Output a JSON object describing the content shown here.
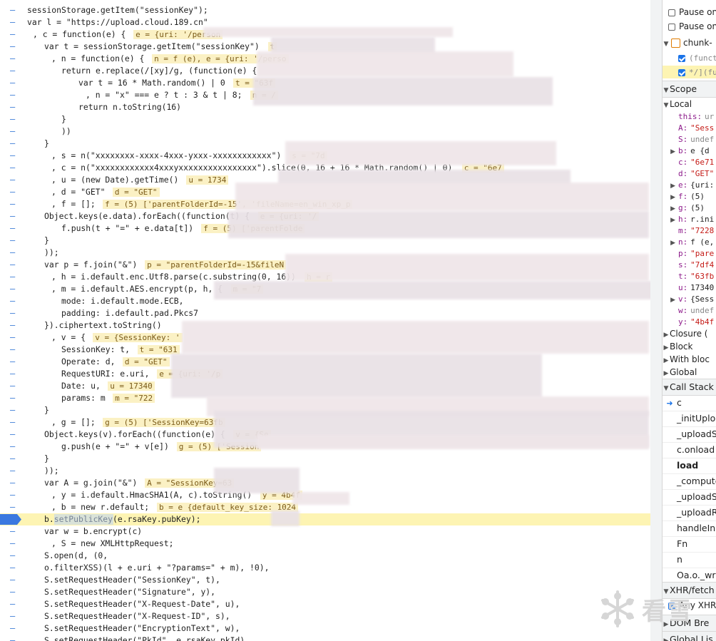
{
  "code": {
    "lines": [
      {
        "text": "sessionStorage.getItem(\"sessionKey\");",
        "indent": 38
      },
      {
        "text": "var l = \"https://upload.cloud.189.cn\"",
        "indent": 38
      },
      {
        "text": ", c = function(e) {",
        "indent": 46,
        "inline": "e = {uri: '/person"
      },
      {
        "text": "var t = sessionStorage.getItem(\"sessionKey\")",
        "indent": 62,
        "inline": "t"
      },
      {
        "text": ", n = function(e) {",
        "indent": 72,
        "inline": "n = f (e), e = {uri: '/perso"
      },
      {
        "text": "return e.replace(/[xy]/g, (function(e) {",
        "indent": 86
      },
      {
        "text": "var t = 16 * Math.random() | 0",
        "indent": 110,
        "inline": "t = \"63f"
      },
      {
        "text": ", n = \"x\" === e ? t : 3 & t | 8;",
        "indent": 120,
        "inline": "n = /"
      },
      {
        "text": "return n.toString(16)",
        "indent": 110
      },
      {
        "text": "}",
        "indent": 86
      },
      {
        "text": "))",
        "indent": 86
      },
      {
        "text": "}",
        "indent": 62
      },
      {
        "text": ", s = n(\"xxxxxxxx-xxxx-4xxx-yxxx-xxxxxxxxxxxx\")",
        "indent": 72,
        "inline": "s = \"7d"
      },
      {
        "text": ", c = n(\"xxxxxxxxxxxx4xxxyxxxxxxxxxxxxxxxx\").slice(0, 16 + 16 * Math.random() | 0)",
        "indent": 72,
        "inline": "c = \"6e7"
      },
      {
        "text": ", u = (new Date).getTime()",
        "indent": 72,
        "inline": "u = 1734"
      },
      {
        "text": ", d = \"GET\"",
        "indent": 72,
        "inline": "d = \"GET\""
      },
      {
        "text": ", f = [];",
        "indent": 72,
        "inline": "f = (5) ['parentFolderId=-15', 'fileName=en_win_xp_p"
      },
      {
        "text": "Object.keys(e.data).forEach((function(t) {",
        "indent": 62,
        "inline": "e = {uri: '/"
      },
      {
        "text": "f.push(t + \"=\" + e.data[t])",
        "indent": 86,
        "inline": "f = (5) ['parentFolde"
      },
      {
        "text": "}",
        "indent": 62
      },
      {
        "text": "));",
        "indent": 62
      },
      {
        "text": "var p = f.join(\"&\")",
        "indent": 62,
        "inline": "p = \"parentFolderId=-15&fileN"
      },
      {
        "text": ", h = i.default.enc.Utf8.parse(c.substring(0, 16))",
        "indent": 72,
        "inline": "h = r"
      },
      {
        "text": ", m = i.default.AES.encrypt(p, h, {",
        "indent": 72,
        "inline": "m = \"7"
      },
      {
        "text": "mode: i.default.mode.ECB,",
        "indent": 86
      },
      {
        "text": "padding: i.default.pad.Pkcs7",
        "indent": 86
      },
      {
        "text": "}).ciphertext.toString()",
        "indent": 62
      },
      {
        "text": ", v = {",
        "indent": 72,
        "inline": "v = {SessionKey: '"
      },
      {
        "text": "SessionKey: t,",
        "indent": 86,
        "inline": "t = \"631"
      },
      {
        "text": "Operate: d,",
        "indent": 86,
        "inline": "d = \"GET\""
      },
      {
        "text": "RequestURI: e.uri,",
        "indent": 86,
        "inline": "e = {uri: '/p"
      },
      {
        "text": "Date: u,",
        "indent": 86,
        "inline": "u = 17340"
      },
      {
        "text": "params: m",
        "indent": 86,
        "inline": "m = \"722"
      },
      {
        "text": "}",
        "indent": 62
      },
      {
        "text": ", g = [];",
        "indent": 72,
        "inline": "g = (5) ['SessionKey=63fb"
      },
      {
        "text": "Object.keys(v).forEach((function(e) {",
        "indent": 62,
        "inline": "v = {Se"
      },
      {
        "text": "g.push(e + \"=\" + v[e])",
        "indent": 86,
        "inline": "g = (5) ['Session"
      },
      {
        "text": "}",
        "indent": 62
      },
      {
        "text": "));",
        "indent": 62
      },
      {
        "text": "var A = g.join(\"&\")",
        "indent": 62,
        "inline": "A = \"SessionKey=63"
      },
      {
        "text": ", y = i.default.HmacSHA1(A, c).toString()",
        "indent": 72,
        "inline": "y = 4b4f"
      },
      {
        "text": ", b = new r.default;",
        "indent": 72,
        "inline": "b = e {default_key_size: 1024"
      },
      {
        "text": "b.setPublicKey(e.rsaKey.pubKey);",
        "indent": 62,
        "current": true
      },
      {
        "text": "var w = b.encrypt(c)",
        "indent": 62
      },
      {
        "text": ", S = new XMLHttpRequest;",
        "indent": 72
      },
      {
        "text": "S.open(d, (0,",
        "indent": 62
      },
      {
        "text": "o.filterXSS)(l + e.uri + \"?params=\" + m), !0),",
        "indent": 62
      },
      {
        "text": "S.setRequestHeader(\"SessionKey\", t),",
        "indent": 62
      },
      {
        "text": "S.setRequestHeader(\"Signature\", y),",
        "indent": 62
      },
      {
        "text": "S.setRequestHeader(\"X-Request-Date\", u),",
        "indent": 62
      },
      {
        "text": "S.setRequestHeader(\"X-Request-ID\", s),",
        "indent": 62
      },
      {
        "text": "S.setRequestHeader(\"EncryptionText\", w),",
        "indent": 62
      },
      {
        "text": "S.setRequestHeader(\"PkId\", e.rsaKey.pkId),",
        "indent": 62
      }
    ],
    "gutter_mark": "–"
  },
  "sidebar": {
    "pause_options": [
      "Pause on",
      "Pause on"
    ],
    "breakpoints_file": "chunk-",
    "breakpoint_items": [
      "(funct",
      "*/](fu"
    ],
    "scope_title": "Scope",
    "local_title": "Local",
    "local_vars": [
      {
        "name": "this:",
        "value": "ur",
        "kind": "gray"
      },
      {
        "name": "A:",
        "value": "\"Sess",
        "kind": "str"
      },
      {
        "name": "S:",
        "value": "undef",
        "kind": "gray"
      },
      {
        "name": "b:",
        "value": "e {d",
        "kind": "obj",
        "expand": true
      },
      {
        "name": "c:",
        "value": "\"6e71",
        "kind": "str"
      },
      {
        "name": "d:",
        "value": "\"GET\"",
        "kind": "str"
      },
      {
        "name": "e:",
        "value": "{uri:",
        "kind": "obj",
        "expand": true
      },
      {
        "name": "f:",
        "value": "(5)",
        "kind": "obj",
        "expand": true
      },
      {
        "name": "g:",
        "value": "(5)",
        "kind": "obj",
        "expand": true
      },
      {
        "name": "h:",
        "value": "r.ini",
        "kind": "obj",
        "expand": true
      },
      {
        "name": "m:",
        "value": "\"7228",
        "kind": "str"
      },
      {
        "name": "n:",
        "value": "f (e,",
        "kind": "obj",
        "expand": true
      },
      {
        "name": "p:",
        "value": "\"pare",
        "kind": "str"
      },
      {
        "name": "s:",
        "value": "\"7df4",
        "kind": "str"
      },
      {
        "name": "t:",
        "value": "\"63fb",
        "kind": "str"
      },
      {
        "name": "u:",
        "value": "17340",
        "kind": "num"
      },
      {
        "name": "v:",
        "value": "{Sess",
        "kind": "obj",
        "expand": true
      },
      {
        "name": "w:",
        "value": "undef",
        "kind": "gray"
      },
      {
        "name": "y:",
        "value": "\"4b4f",
        "kind": "str"
      }
    ],
    "scope_groups": [
      "Closure (",
      "Block",
      "With bloc",
      "Global"
    ],
    "call_stack_title": "Call Stack",
    "call_stack": [
      {
        "label": "c",
        "active": true
      },
      {
        "label": "_initUplo"
      },
      {
        "label": "_uploadSt"
      },
      {
        "label": "c.onload"
      },
      {
        "label": "load",
        "bold": true
      },
      {
        "label": "_compute"
      },
      {
        "label": "_uploadSt"
      },
      {
        "label": "_uploadRe"
      },
      {
        "label": "handleInp"
      },
      {
        "label": "Fn"
      },
      {
        "label": "n"
      },
      {
        "label": "Oa.o._wra"
      }
    ],
    "xhr_title": "XHR/fetch",
    "any_xhr": "Any XHR",
    "dom_breakpoints": "DOM Bre",
    "global_listeners": "Global Lis"
  },
  "watermark": {
    "text": "看雪"
  },
  "colors": {
    "accent": "#1a73e8",
    "current_line": "#fdf4b3",
    "inline_value_bg": "#fbf1c4"
  }
}
